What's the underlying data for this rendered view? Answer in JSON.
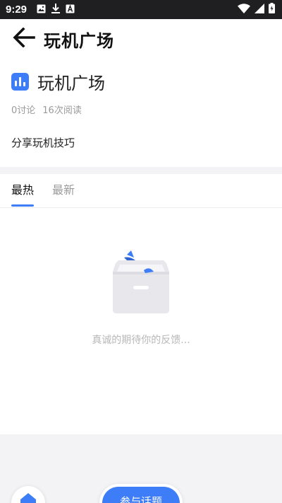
{
  "status_bar": {
    "time": "9:29",
    "left_icons": [
      "image-icon",
      "download-icon",
      "font-icon"
    ],
    "right_icons": [
      "wifi-icon",
      "signal-icon",
      "battery-icon"
    ]
  },
  "header": {
    "title": "玩机广场"
  },
  "topic": {
    "title": "玩机广场",
    "discussions": "0讨论",
    "reads": "16次阅读",
    "description": "分享玩机技巧"
  },
  "tabs": [
    {
      "label": "最热",
      "active": true
    },
    {
      "label": "最新",
      "active": false
    }
  ],
  "empty_state": {
    "text": "真诚的期待你的反馈..."
  },
  "bottom": {
    "join_label": "参与话题"
  },
  "colors": {
    "accent": "#3d7df7",
    "status_bar": "#1f1f22",
    "divider": "#f3f3f5"
  }
}
